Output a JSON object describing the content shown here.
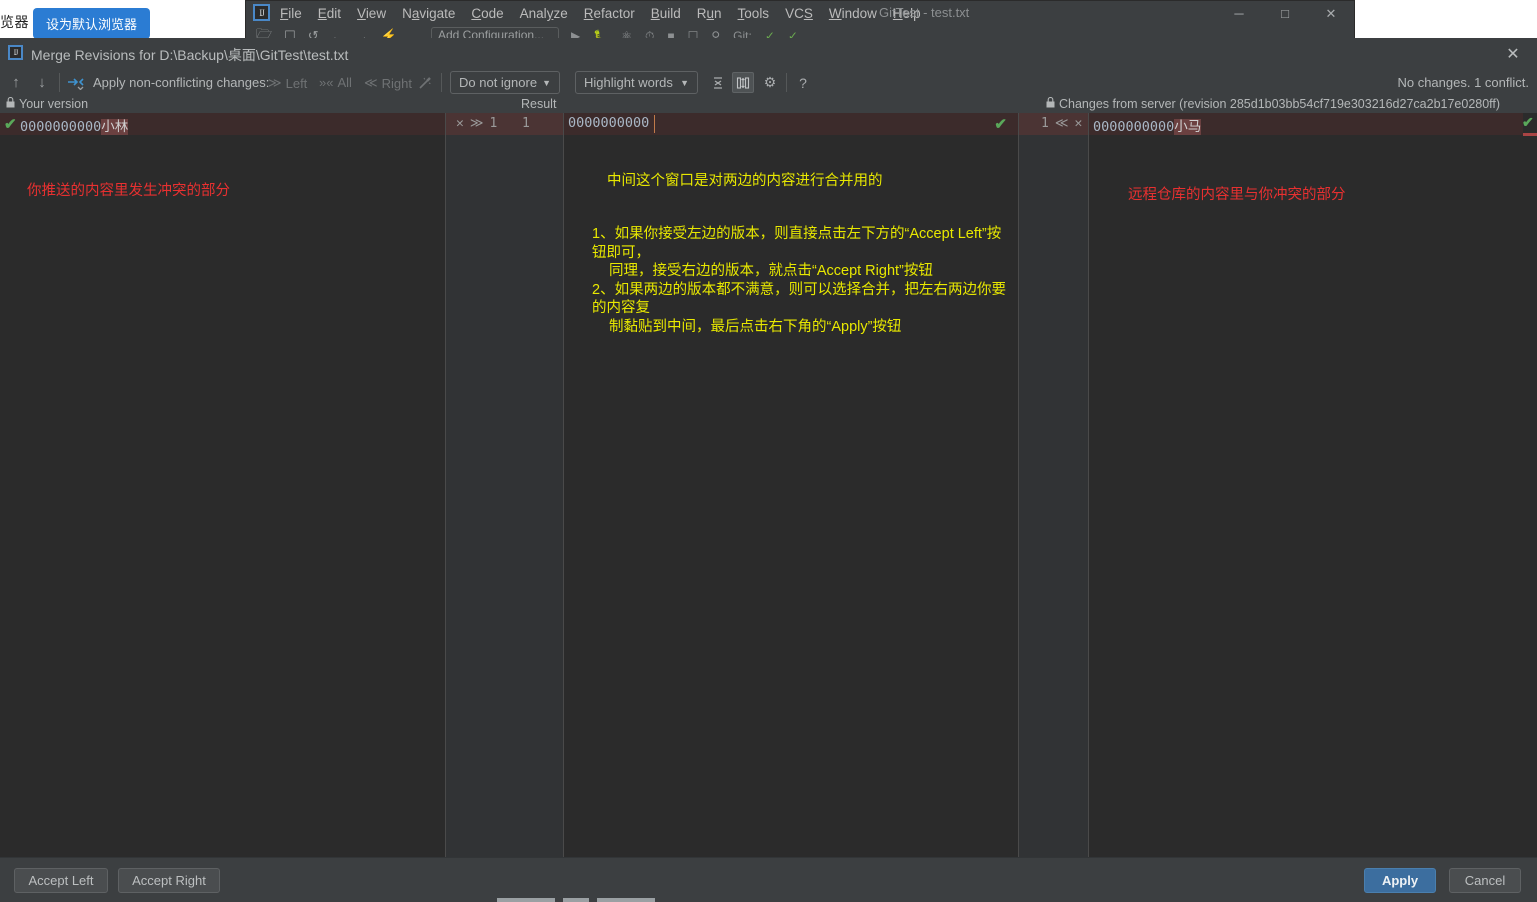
{
  "background": {
    "browser_fragment_label": "览器",
    "default_browser_button": "设为默认浏览器",
    "idea_window": {
      "logo": "IJ",
      "menus": [
        {
          "pre": "",
          "mn": "F",
          "post": "ile"
        },
        {
          "pre": "",
          "mn": "E",
          "post": "dit"
        },
        {
          "pre": "",
          "mn": "V",
          "post": "iew"
        },
        {
          "pre": "N",
          "mn": "a",
          "post": "vigate"
        },
        {
          "pre": "",
          "mn": "C",
          "post": "ode"
        },
        {
          "pre": "Anal",
          "mn": "y",
          "post": "ze"
        },
        {
          "pre": "",
          "mn": "R",
          "post": "efactor"
        },
        {
          "pre": "",
          "mn": "B",
          "post": "uild"
        },
        {
          "pre": "R",
          "mn": "u",
          "post": "n"
        },
        {
          "pre": "",
          "mn": "T",
          "post": "ools"
        },
        {
          "pre": "VC",
          "mn": "S",
          "post": ""
        },
        {
          "pre": "",
          "mn": "W",
          "post": "indow"
        },
        {
          "pre": "",
          "mn": "H",
          "post": "elp"
        }
      ],
      "title": "GitTest - test.txt",
      "window_controls": {
        "minimize": "─",
        "maximize": "□",
        "close": "✕"
      },
      "run_config_placeholder": "Add Configuration..."
    }
  },
  "dialog": {
    "logo": "IJ",
    "title": "Merge Revisions for D:\\Backup\\桌面\\GitTest\\test.txt",
    "close_icon": "✕",
    "toolbar": {
      "prev_diff_icon": "↑",
      "next_diff_icon": "↓",
      "magic_resolve_icon": "⯈",
      "apply_label": "Apply non-conflicting changes:",
      "left_label": "Left",
      "all_label": "All",
      "right_label": "Right",
      "wand_icon": "✨",
      "ignore_combo": "Do not ignore",
      "highlight_combo": "Highlight words",
      "collapse_icon": "⤓",
      "columns_icon": "⦀",
      "settings_icon": "⚙",
      "help_icon": "?",
      "status": "No changes. 1 conflict."
    },
    "headers": {
      "left": "Your version",
      "left_lock": "🔒",
      "middle": "Result",
      "right": "Changes from server (revision 285d1b03bb54cf719e303216d27ca2b17e0280ff)",
      "right_lock": "🔒"
    },
    "panes": {
      "left": {
        "accept_check": "✔",
        "line_prefix": "0000000000",
        "line_highlight": "小林",
        "annotation": "你推送的内容里发生冲突的部分"
      },
      "middle": {
        "gutter_left": {
          "revert_icon": "✕",
          "accept_icon": "≫",
          "left_number": "1",
          "right_number": "1"
        },
        "line_text": "0000000000",
        "accept_check": "✔",
        "annotation_title": "中间这个窗口是对两边的内容进行合并用的",
        "annotation_item1_line1": "1、如果你接受左边的版本，则直接点击左下方的“Accept Left”按钮即可，",
        "annotation_item1_line2": "同理，接受右边的版本，就点击“Accept Right”按钮",
        "annotation_item2_line1": "2、如果两边的版本都不满意，则可以选择合并，把左右两边你要的内容复",
        "annotation_item2_line2": "制黏贴到中间，最后点击右下角的“Apply”按钮"
      },
      "right": {
        "gutter": {
          "number": "1",
          "accept_icon": "≪",
          "revert_icon": "✕"
        },
        "line_prefix": "0000000000",
        "line_highlight": "小马",
        "annotation": "远程仓库的内容里与你冲突的部分",
        "overview_check": "✔"
      }
    },
    "buttons": {
      "accept_left": "Accept Left",
      "accept_right": "Accept Right",
      "apply": "Apply",
      "cancel": "Cancel"
    }
  },
  "colors": {
    "dialog_bg": "#3c3f41",
    "editor_bg": "#2b2b2b",
    "conflict_row": "#3c2b2b",
    "accent_blue": "#3c6e9f",
    "annotation_red": "#e83030",
    "annotation_yellow": "#e8e800",
    "check_green": "#5aa85a"
  }
}
